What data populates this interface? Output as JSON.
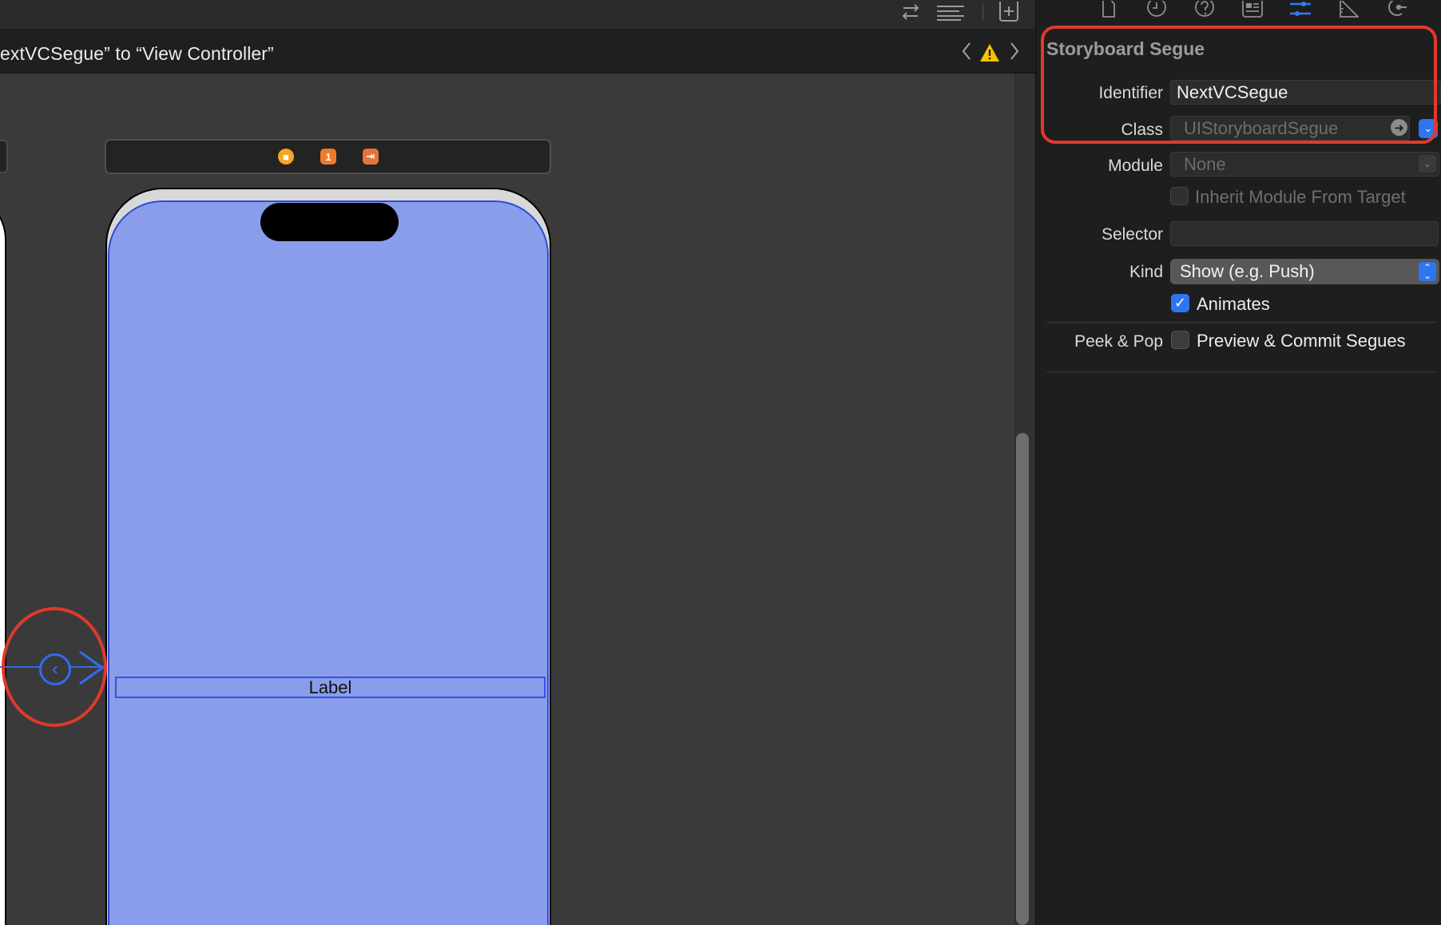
{
  "jumpbar": {
    "title": "extVCSegue” to “View Controller”",
    "back_icon": "chevron-left-icon",
    "forward_icon": "chevron-right-icon",
    "warning_icon": "warning-triangle-icon"
  },
  "toolbar": {
    "icons": [
      "swap-arrows-icon",
      "editor-options-icon",
      "add-editor-icon"
    ]
  },
  "canvas": {
    "label_text": "Label",
    "dock_icons": [
      "view-controller-icon",
      "first-responder-icon",
      "exit-icon"
    ],
    "dock_icon_texts": [
      "■",
      "1",
      "⇥"
    ],
    "segue_glyph": "‹"
  },
  "inspector": {
    "tabs": [
      "file-icon",
      "history-icon",
      "help-icon",
      "identity-icon",
      "attributes-icon",
      "size-icon",
      "connections-icon"
    ],
    "active_tab": "attributes-icon",
    "section_title": "Storyboard Segue",
    "identifier": {
      "label": "Identifier",
      "value": "NextVCSegue"
    },
    "class": {
      "label": "Class",
      "placeholder": "UIStoryboardSegue"
    },
    "module": {
      "label": "Module",
      "placeholder": "None"
    },
    "inherit": {
      "label": "Inherit Module From Target",
      "checked": false
    },
    "selector": {
      "label": "Selector",
      "value": ""
    },
    "kind": {
      "label": "Kind",
      "value": "Show (e.g. Push)"
    },
    "animates": {
      "label": "Animates",
      "checked": true
    },
    "peek_pop": {
      "label": "Peek & Pop",
      "option": "Preview & Commit Segues",
      "checked": false
    }
  },
  "colors": {
    "accent": "#2e76f0",
    "annotation_red": "#e0382c",
    "scene_background": "#8a9deb"
  }
}
